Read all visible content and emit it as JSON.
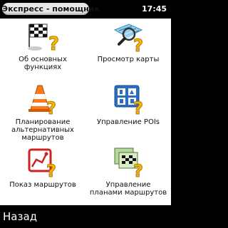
{
  "header": {
    "title": "Экспресс - помощник",
    "time": "17:45"
  },
  "menu": [
    {
      "label_lines": [
        "Об основных",
        "функциях"
      ],
      "icon": "checkered-flag-help-icon"
    },
    {
      "label_lines": [
        "Просмотр карты"
      ],
      "icon": "map-magnifier-help-icon"
    },
    {
      "label_lines": [
        "Планирование",
        "альтернативных",
        "маршрутов"
      ],
      "icon": "traffic-cone-help-icon"
    },
    {
      "label_lines": [
        "Управление POIs"
      ],
      "icon": "poi-signs-help-icon"
    },
    {
      "label_lines": [
        "Показ маршрутов"
      ],
      "icon": "route-display-help-icon"
    },
    {
      "label_lines": [
        "Управление",
        "планами маршрутов"
      ],
      "icon": "route-plans-help-icon"
    }
  ],
  "footer": {
    "back_label": "Назад"
  }
}
